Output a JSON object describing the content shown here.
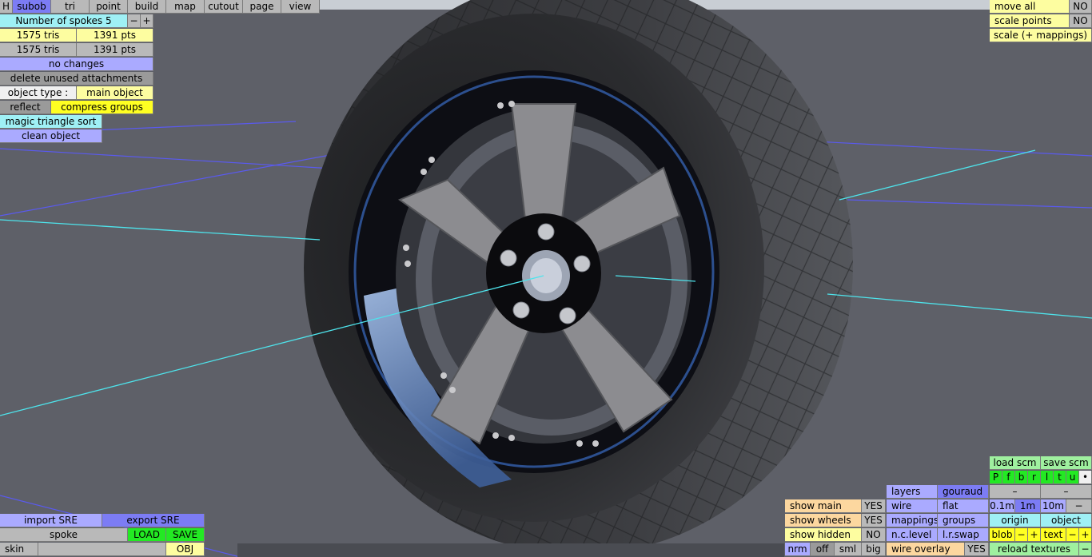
{
  "top_menu": [
    "H",
    "subob",
    "tri",
    "point",
    "build",
    "map",
    "cutout",
    "page",
    "view"
  ],
  "left_panel": {
    "spokes_label": "Number of spokes 5",
    "minus": "−",
    "plus": "+",
    "stats_row1": [
      "1575 tris",
      "1391 pts"
    ],
    "stats_row2": [
      "1575 tris",
      "1391 pts"
    ],
    "no_changes": "no changes",
    "delete_unused": "delete unused attachments",
    "object_type_label": "object type :",
    "object_type_value": "main object",
    "reflect": "reflect",
    "compress_groups": "compress groups",
    "magic_sort": "magic triangle sort",
    "clean_object": "clean object"
  },
  "top_right": {
    "move_all": "move all",
    "move_all_value": "NO",
    "scale_points": "scale points",
    "scale_points_value": "NO",
    "scale_mappings": "scale (+ mappings)"
  },
  "bottom_left": {
    "import_sre": "import SRE",
    "export_sre": "export SRE",
    "spoke": "spoke",
    "load": "LOAD",
    "save": "SAVE",
    "skin": "skin",
    "obj": "OBJ"
  },
  "bottom_right": {
    "show_main": "show main",
    "show_main_value": "YES",
    "show_wheels": "show wheels",
    "show_wheels_value": "YES",
    "show_hidden": "show hidden",
    "show_hidden_value": "NO",
    "nrm": "nrm",
    "off": "off",
    "sml": "sml",
    "big": "big",
    "layers": "layers",
    "gouraud": "gouraud",
    "wire": "wire",
    "flat": "flat",
    "mappings": "mappings",
    "groups": "groups",
    "nc_level": "n.c.level",
    "lr_swap": "l.r.swap",
    "wire_overlay": "wire overlay",
    "wire_overlay_value": "YES",
    "load_scm": "load scm",
    "save_scm": "save scm",
    "view_letters": [
      "P",
      "f",
      "b",
      "r",
      "l",
      "t",
      "u",
      "•"
    ],
    "dash1": "–",
    "dash2": "–",
    "grid_01": "0.1m",
    "grid_1": "1m",
    "grid_10": "10m",
    "grid_minus": "−",
    "origin": "origin",
    "object": "object",
    "blob": "blob",
    "blob_minus": "−",
    "blob_plus": "+",
    "text": "text",
    "text_minus": "−",
    "text_plus": "+",
    "reload_textures": "reload textures",
    "reload_minus": "−"
  }
}
